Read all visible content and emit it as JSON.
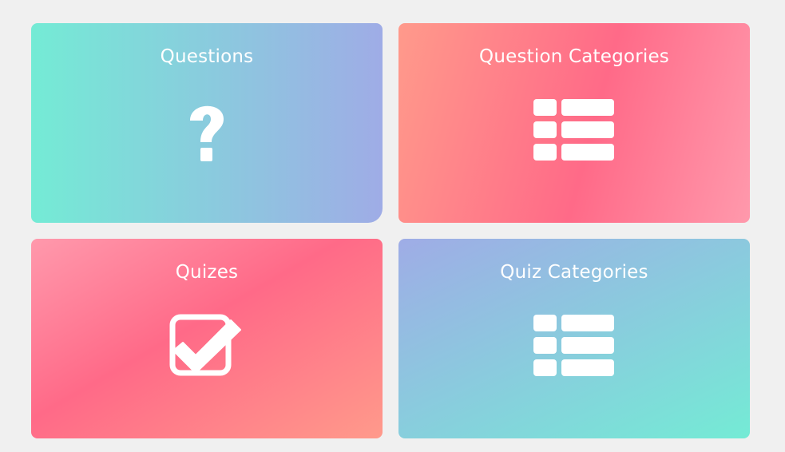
{
  "cards": [
    {
      "title": "Questions",
      "icon": "question-mark-icon"
    },
    {
      "title": "Question Categories",
      "icon": "list-icon"
    },
    {
      "title": "Quizes",
      "icon": "checkbox-checked-icon"
    },
    {
      "title": "Quiz Categories",
      "icon": "list-icon"
    }
  ],
  "colors": {
    "page_background": "#f0f0f0",
    "text": "#ffffff",
    "teal": "#74ebd5",
    "lavender": "#9face6",
    "salmon": "#ff9a8b",
    "pink": "#ff6a88",
    "light_pink": "#ff99ac"
  }
}
